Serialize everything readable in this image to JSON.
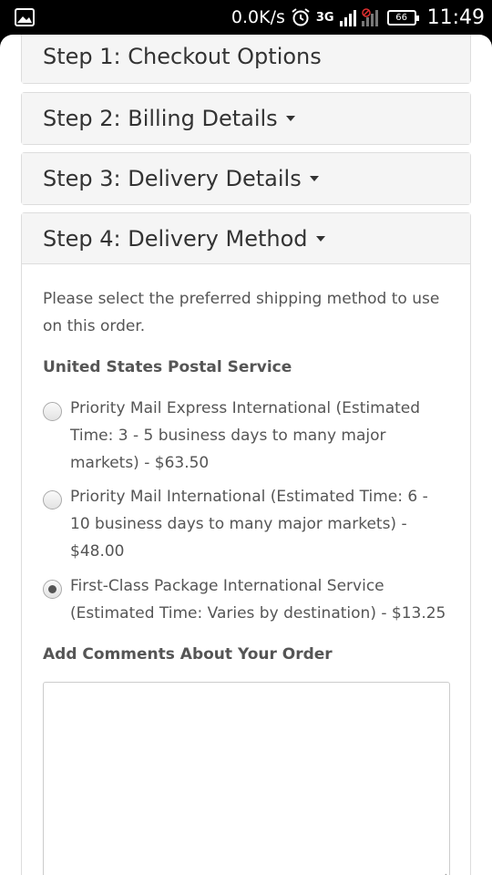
{
  "status_bar": {
    "network_speed": "0.0K/s",
    "network_type": "3G",
    "battery": "66",
    "time": "11:49"
  },
  "steps": [
    {
      "label": "Step 1: Checkout Options"
    },
    {
      "label": "Step 2: Billing Details"
    },
    {
      "label": "Step 3: Delivery Details"
    },
    {
      "label": "Step 4: Delivery Method"
    }
  ],
  "delivery_method": {
    "intro": "Please select the preferred shipping method to use on this order.",
    "carrier": "United States Postal Service",
    "options": [
      {
        "label": "Priority Mail Express International (Estimated Time: 3 - 5 business days to many major markets) - $63.50",
        "selected": false
      },
      {
        "label": "Priority Mail International (Estimated Time: 6 - 10 business days to many major markets) - $48.00",
        "selected": false
      },
      {
        "label": "First-Class Package International Service (Estimated Time: Varies by destination) - $13.25",
        "selected": true
      }
    ],
    "comments_label": "Add Comments About Your Order",
    "comments_value": ""
  }
}
